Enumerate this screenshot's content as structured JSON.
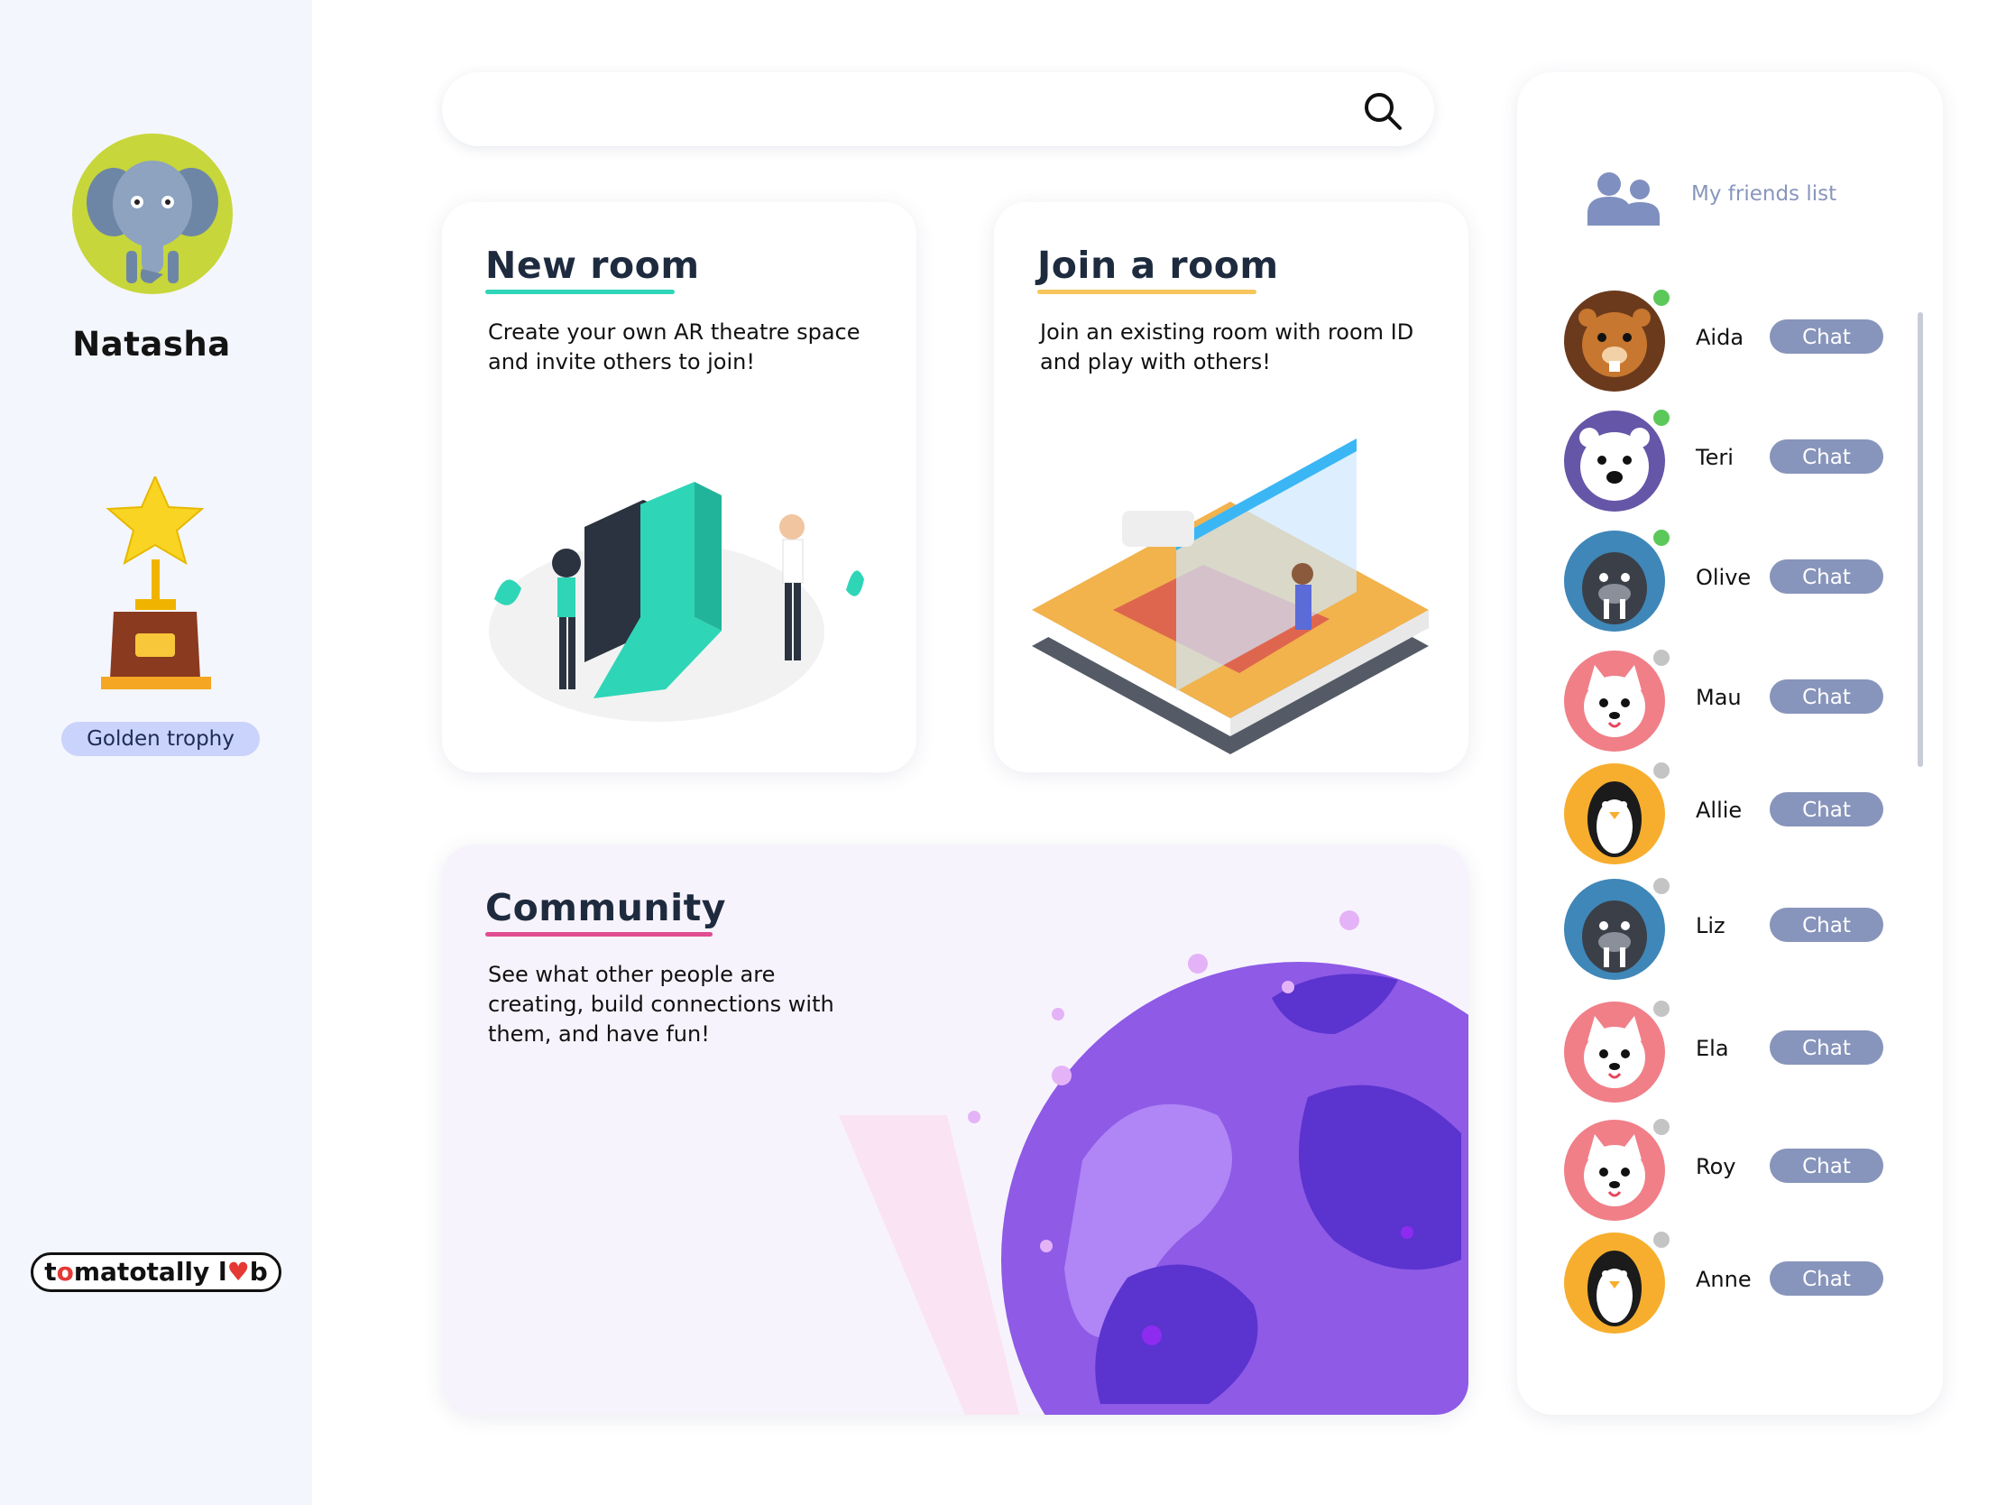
{
  "profile": {
    "name": "Natasha",
    "trophy_label": "Golden trophy"
  },
  "brand": {
    "prefix": "t",
    "tomato": "o",
    "middle": "matotally l",
    "heart": "♥",
    "suffix": "b"
  },
  "search": {
    "placeholder": "",
    "value": ""
  },
  "cards": {
    "new_room": {
      "title": "New room",
      "description": "Create your own AR theatre space and invite others to join!",
      "accent": "#2fd5b7"
    },
    "join_room": {
      "title": "Join a room",
      "description": "Join an existing room with room ID and play with others!",
      "accent": "#f7c55c"
    },
    "community": {
      "title": "Community",
      "description": "See what other people are creating, build connections with them, and have fun!",
      "accent": "#e14b92"
    }
  },
  "friends": {
    "title": "My friends list",
    "chat_label": "Chat",
    "items": [
      {
        "name": "Aida",
        "animal": "beaver",
        "online": true
      },
      {
        "name": "Teri",
        "animal": "polar-bear",
        "online": true
      },
      {
        "name": "Olive",
        "animal": "walrus",
        "online": true
      },
      {
        "name": "Mau",
        "animal": "cat",
        "online": false
      },
      {
        "name": "Allie",
        "animal": "penguin",
        "online": false
      },
      {
        "name": "Liz",
        "animal": "walrus",
        "online": false
      },
      {
        "name": "Ela",
        "animal": "cat",
        "online": false
      },
      {
        "name": "Roy",
        "animal": "cat",
        "online": false
      },
      {
        "name": "Anne",
        "animal": "penguin",
        "online": false
      }
    ]
  },
  "colors": {
    "sidebar_bg": "#f4f6fd",
    "chat_button": "#8794bb",
    "online": "#5cc85a",
    "offline": "#c4c4c4"
  }
}
